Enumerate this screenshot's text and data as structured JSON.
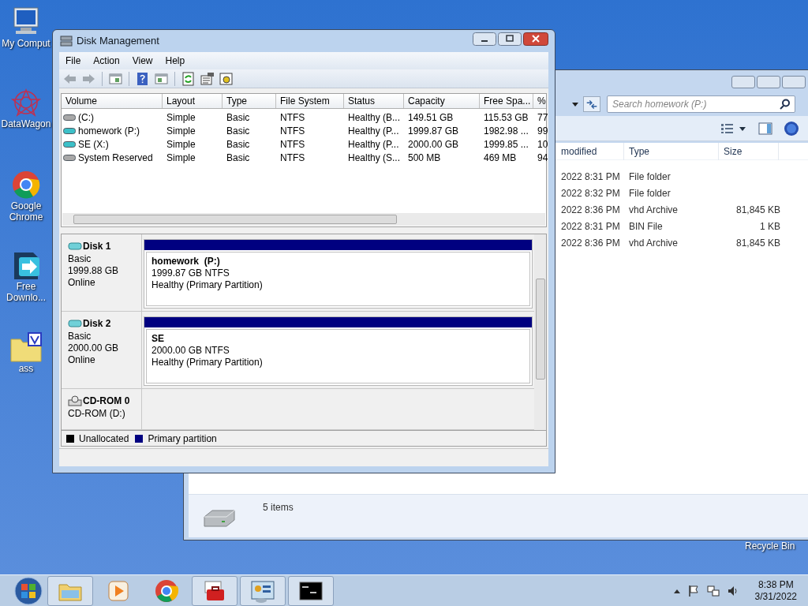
{
  "desktop_icons": [
    {
      "label": "My Comput",
      "kind": "computer"
    },
    {
      "label": "DataWagon",
      "kind": "star"
    },
    {
      "label": "Google Chrome",
      "kind": "chrome"
    },
    {
      "label": "Free Downlo...",
      "kind": "download"
    },
    {
      "label": "ass",
      "kind": "folder"
    }
  ],
  "recycle_bin": {
    "label": "Recycle Bin"
  },
  "explorer": {
    "search": {
      "placeholder": "Search homework (P:)"
    },
    "columns": [
      "modified",
      "Type",
      "Size"
    ],
    "rows": [
      {
        "modified": "2022 8:31 PM",
        "type": "File folder",
        "size": ""
      },
      {
        "modified": "2022 8:32 PM",
        "type": "File folder",
        "size": ""
      },
      {
        "modified": "2022 8:36 PM",
        "type": "vhd Archive",
        "size": "81,845 KB"
      },
      {
        "modified": "2022 8:31 PM",
        "type": "BIN File",
        "size": "1 KB"
      },
      {
        "modified": "2022 8:36 PM",
        "type": "vhd Archive",
        "size": "81,845 KB"
      }
    ],
    "status": "5 items"
  },
  "disk_management": {
    "title": "Disk Management",
    "menu": [
      "File",
      "Action",
      "View",
      "Help"
    ],
    "columns": [
      "Volume",
      "Layout",
      "Type",
      "File System",
      "Status",
      "Capacity",
      "Free Spa...",
      "%"
    ],
    "volumes": [
      {
        "color": "#a8a8a8",
        "cells": [
          "(C:)",
          "Simple",
          "Basic",
          "NTFS",
          "Healthy (B...",
          "149.51 GB",
          "115.53 GB",
          "77"
        ]
      },
      {
        "color": "#3cc0c8",
        "cells": [
          "homework (P:)",
          "Simple",
          "Basic",
          "NTFS",
          "Healthy (P...",
          "1999.87 GB",
          "1982.98 ...",
          "99"
        ]
      },
      {
        "color": "#3cc0c8",
        "cells": [
          "SE (X:)",
          "Simple",
          "Basic",
          "NTFS",
          "Healthy (P...",
          "2000.00 GB",
          "1999.85 ...",
          "10"
        ]
      },
      {
        "color": "#a8a8a8",
        "cells": [
          "System Reserved",
          "Simple",
          "Basic",
          "NTFS",
          "Healthy (S...",
          "500 MB",
          "469 MB",
          "94"
        ]
      }
    ],
    "disks": [
      {
        "kind": "disk",
        "name": "Disk 1",
        "lines": [
          "Basic",
          "1999.88 GB",
          "Online"
        ],
        "partition": {
          "name": "homework  (P:)",
          "size": "1999.87 GB NTFS",
          "status": "Healthy (Primary Partition)"
        }
      },
      {
        "kind": "disk",
        "name": "Disk 2",
        "lines": [
          "Basic",
          "2000.00 GB",
          "Online"
        ],
        "partition": {
          "name": "SE",
          "size": "2000.00 GB NTFS",
          "status": "Healthy (Primary Partition)"
        }
      },
      {
        "kind": "cdrom",
        "name": "CD-ROM 0",
        "lines": [
          "CD-ROM (D:)"
        ]
      }
    ],
    "legend": [
      {
        "label": "Unallocated",
        "color": "#000000"
      },
      {
        "label": "Primary partition",
        "color": "#000080"
      }
    ]
  },
  "clock": {
    "time": "8:38 PM",
    "date": "3/31/2022"
  }
}
